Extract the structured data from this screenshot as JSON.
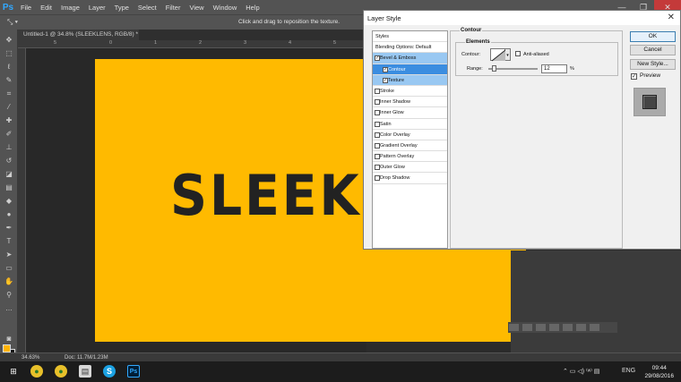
{
  "app": {
    "logo": "Ps"
  },
  "menu": [
    "File",
    "Edit",
    "Image",
    "Layer",
    "Type",
    "Select",
    "Filter",
    "View",
    "Window",
    "Help"
  ],
  "window_controls": {
    "minimize": "—",
    "restore": "❐",
    "close": "✕"
  },
  "options_bar": {
    "tool": "⤡ ▾",
    "hint": "Click and drag to reposition the texture."
  },
  "document": {
    "tab_title": "Untitled-1 @ 34.8% (SLEEKLENS, RGB/8) *",
    "tab_close": "×",
    "canvas_color": "#ffba00",
    "canvas_text": "SLEEKLENS",
    "ruler_marks": [
      "5",
      "0",
      "1",
      "2",
      "3",
      "4",
      "5"
    ]
  },
  "status_bar": {
    "zoom": "34.63%",
    "doc": "Doc: 11.7M/1.23M"
  },
  "colors": {
    "foreground": "#ffb400",
    "background": "#111111",
    "accent": "#3b8de0"
  },
  "dialog": {
    "title": "Layer Style",
    "close_label": "✕",
    "styles": [
      {
        "label": "Styles",
        "kind": "header"
      },
      {
        "label": "Blending Options: Default",
        "kind": "header"
      },
      {
        "label": "Bevel & Emboss",
        "kind": "item",
        "checked": true,
        "state": "highlight"
      },
      {
        "label": "Contour",
        "kind": "sub",
        "checked": true,
        "state": "selected"
      },
      {
        "label": "Texture",
        "kind": "sub",
        "checked": true,
        "state": "highlight"
      },
      {
        "label": "Stroke",
        "kind": "item",
        "checked": false
      },
      {
        "label": "Inner Shadow",
        "kind": "item",
        "checked": false
      },
      {
        "label": "Inner Glow",
        "kind": "item",
        "checked": false
      },
      {
        "label": "Satin",
        "kind": "item",
        "checked": false
      },
      {
        "label": "Color Overlay",
        "kind": "item",
        "checked": false
      },
      {
        "label": "Gradient Overlay",
        "kind": "item",
        "checked": false
      },
      {
        "label": "Pattern Overlay",
        "kind": "item",
        "checked": false
      },
      {
        "label": "Outer Glow",
        "kind": "item",
        "checked": false
      },
      {
        "label": "Drop Shadow",
        "kind": "item",
        "checked": false
      }
    ],
    "contour": {
      "section_title": "Contour",
      "group_title": "Elements",
      "contour_label": "Contour:",
      "anti_aliased_label": "Anti-aliased",
      "anti_aliased_checked": false,
      "range_label": "Range:",
      "range_value": "12",
      "range_unit": "%",
      "range_level_percent": 12
    },
    "buttons": {
      "ok": "OK",
      "cancel": "Cancel",
      "new_style": "New Style..."
    },
    "preview": {
      "label": "Preview",
      "checked": true
    }
  },
  "taskbar": {
    "icons": [
      "windows-logo",
      "chrome",
      "chrome",
      "file-explorer",
      "skype",
      "photoshop"
    ],
    "tray": "⌃  ▭  ◁)  ⁽ʷ⁾  ▤",
    "language": "ENG",
    "time": "09:44",
    "date": "29/08/2016"
  }
}
